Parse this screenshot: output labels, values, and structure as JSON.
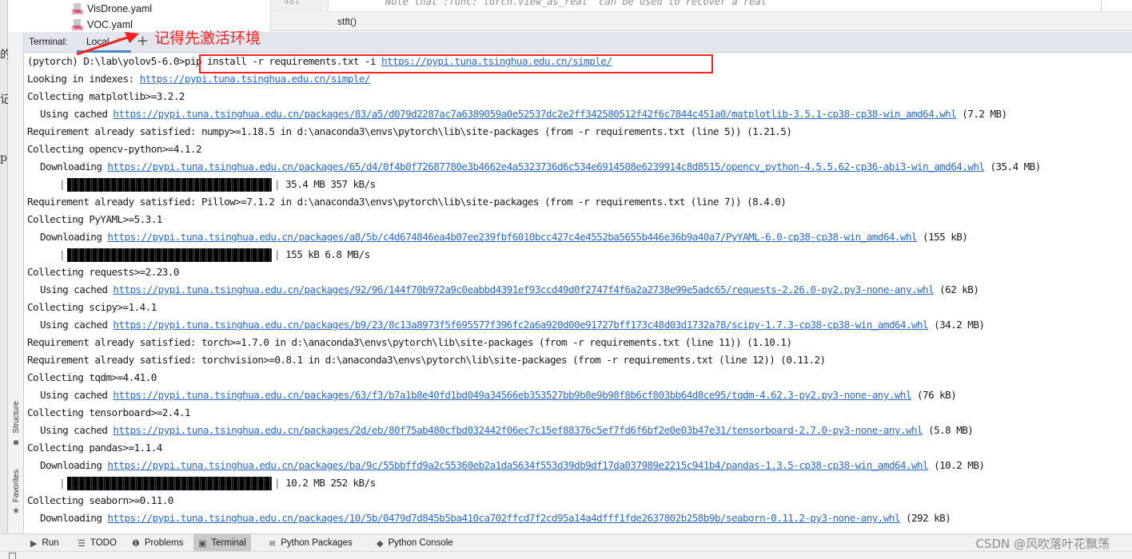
{
  "left_fragments": [
    "的",
    "记",
    "p"
  ],
  "project_tree": {
    "items": [
      {
        "name": "VisDrone.yaml",
        "icon": "yaml-file-icon",
        "icon_tag": "YML"
      },
      {
        "name": "VOC.yaml",
        "icon": "yaml-file-icon",
        "icon_tag": "YML"
      }
    ]
  },
  "editor": {
    "line_number": "481",
    "code_line": "Note that :func:`torch.view_as_real` can be used to recover a real",
    "breadcrumb": "stft()"
  },
  "terminal": {
    "title": "Terminal:",
    "tabs": [
      {
        "label": "Local",
        "active": true
      }
    ],
    "add_tab_label": "+",
    "annotation": "记得先激活环境",
    "prompt": "(pytorch) D:\\lab\\yolov5-6.0>",
    "command": "pip install -r requirements.txt -i ",
    "command_url": "https://pypi.tuna.tsinghua.edu.cn/simple/",
    "lines": [
      {
        "type": "text",
        "pre": "Looking in indexes: ",
        "url": "https://pypi.tuna.tsinghua.edu.cn/simple/",
        "post": ""
      },
      {
        "type": "text",
        "pre": "Collecting matplotlib>=3.2.2",
        "url": "",
        "post": ""
      },
      {
        "type": "sub",
        "pre": "Using cached ",
        "url": "https://pypi.tuna.tsinghua.edu.cn/packages/83/a5/d079d2287ac7a6389059a0e52537dc2e2ff342580512f42f6c7844c451a0/matplotlib-3.5.1-cp38-cp38-win_amd64.whl",
        "post": " (7.2 MB)"
      },
      {
        "type": "text",
        "pre": "Requirement already satisfied: numpy>=1.18.5 in d:\\anaconda3\\envs\\pytorch\\lib\\site-packages (from -r requirements.txt (line 5)) (1.21.5)",
        "url": "",
        "post": ""
      },
      {
        "type": "text",
        "pre": "Collecting opencv-python>=4.1.2",
        "url": "",
        "post": ""
      },
      {
        "type": "sub",
        "pre": "Downloading ",
        "url": "https://pypi.tuna.tsinghua.edu.cn/packages/65/d4/0f4b0f72687780e3b4662e4a5323736d6c534e6914508e6239914c8d8515/opencv_python-4.5.5.62-cp36-abi3-win_amd64.whl",
        "post": " (35.4 MB)"
      },
      {
        "type": "progress",
        "progress": 1.0,
        "info": "35.4 MB 357 kB/s"
      },
      {
        "type": "text",
        "pre": "Requirement already satisfied: Pillow>=7.1.2 in d:\\anaconda3\\envs\\pytorch\\lib\\site-packages (from -r requirements.txt (line 7)) (8.4.0)",
        "url": "",
        "post": ""
      },
      {
        "type": "text",
        "pre": "Collecting PyYAML>=5.3.1",
        "url": "",
        "post": ""
      },
      {
        "type": "sub",
        "pre": "Downloading ",
        "url": "https://pypi.tuna.tsinghua.edu.cn/packages/a8/5b/c4d674846ea4b07ee239fbf6010bcc427c4e4552ba5655b446e36b9a40a7/PyYAML-6.0-cp38-cp38-win_amd64.whl",
        "post": " (155 kB)"
      },
      {
        "type": "progress",
        "progress": 1.0,
        "info": "155 kB 6.8 MB/s"
      },
      {
        "type": "text",
        "pre": "Collecting requests>=2.23.0",
        "url": "",
        "post": ""
      },
      {
        "type": "sub",
        "pre": "Using cached ",
        "url": "https://pypi.tuna.tsinghua.edu.cn/packages/92/96/144f70b972a9c0eabbd4391ef93ccd49d0f2747f4f6a2a2738e99e5adc65/requests-2.26.0-py2.py3-none-any.whl",
        "post": " (62 kB)"
      },
      {
        "type": "text",
        "pre": "Collecting scipy>=1.4.1",
        "url": "",
        "post": ""
      },
      {
        "type": "sub",
        "pre": "Using cached ",
        "url": "https://pypi.tuna.tsinghua.edu.cn/packages/b9/23/8c13a8973f5f695577f396fc2a6a920d00e91727bff173c48d03d1732a78/scipy-1.7.3-cp38-cp38-win_amd64.whl",
        "post": " (34.2 MB)"
      },
      {
        "type": "text",
        "pre": "Requirement already satisfied: torch>=1.7.0 in d:\\anaconda3\\envs\\pytorch\\lib\\site-packages (from -r requirements.txt (line 11)) (1.10.1)",
        "url": "",
        "post": ""
      },
      {
        "type": "text",
        "pre": "Requirement already satisfied: torchvision>=0.8.1 in d:\\anaconda3\\envs\\pytorch\\lib\\site-packages (from -r requirements.txt (line 12)) (0.11.2)",
        "url": "",
        "post": ""
      },
      {
        "type": "text",
        "pre": "Collecting tqdm>=4.41.0",
        "url": "",
        "post": ""
      },
      {
        "type": "sub",
        "pre": "Using cached ",
        "url": "https://pypi.tuna.tsinghua.edu.cn/packages/63/f3/b7a1b8e40fd1bd049a34566eb353527bb9b8e9b98f8b6cf803bb64d8ce95/tqdm-4.62.3-py2.py3-none-any.whl",
        "post": " (76 kB)"
      },
      {
        "type": "text",
        "pre": "Collecting tensorboard>=2.4.1",
        "url": "",
        "post": ""
      },
      {
        "type": "sub",
        "pre": "Using cached ",
        "url": "https://pypi.tuna.tsinghua.edu.cn/packages/2d/eb/80f75ab480cfbd032442f06ec7c15ef88376c5ef7fd6f6bf2e0e03b47e31/tensorboard-2.7.0-py3-none-any.whl",
        "post": " (5.8 MB)"
      },
      {
        "type": "text",
        "pre": "Collecting pandas>=1.1.4",
        "url": "",
        "post": ""
      },
      {
        "type": "sub",
        "pre": "Downloading ",
        "url": "https://pypi.tuna.tsinghua.edu.cn/packages/ba/9c/55bbffd9a2c55360eb2a1da5634f553d39db9df17da037989e2215c941b4/pandas-1.3.5-cp38-cp38-win_amd64.whl",
        "post": " (10.2 MB)"
      },
      {
        "type": "progress",
        "progress": 1.0,
        "info": "10.2 MB 252 kB/s"
      },
      {
        "type": "text",
        "pre": "Collecting seaborn>=0.11.0",
        "url": "",
        "post": ""
      },
      {
        "type": "sub",
        "pre": "Downloading ",
        "url": "https://pypi.tuna.tsinghua.edu.cn/packages/10/5b/0479d7d845b5ba410ca702ffcd7f2cd95a14a4dfff1fde2637802b258b9b/seaborn-0.11.2-py3-none-any.whl",
        "post": " (292 kB)"
      }
    ]
  },
  "side_tabs": {
    "structure": "Structure",
    "favorites": "Favorites"
  },
  "bottom_tabs": [
    {
      "label": "Run",
      "icon": "run-icon",
      "glyph": "▶",
      "active": false
    },
    {
      "label": "TODO",
      "icon": "todo-list-icon",
      "glyph": "☰",
      "active": false
    },
    {
      "label": "Problems",
      "icon": "problems-icon",
      "glyph": "❶",
      "active": false
    },
    {
      "label": "Terminal",
      "icon": "terminal-icon",
      "glyph": "▣",
      "active": true
    },
    {
      "label": "Python Packages",
      "icon": "python-packages-icon",
      "glyph": "≋",
      "active": false
    },
    {
      "label": "Python Console",
      "icon": "python-console-icon",
      "glyph": "◆",
      "active": false
    }
  ],
  "watermark": "CSDN @风吹落叶花飘荡",
  "colors": {
    "link": "#2a6bc9",
    "annotation": "#ff1f1f",
    "terminal_header_bg": "#e4e6ee",
    "active_tab_underline": "#4a86c8"
  }
}
